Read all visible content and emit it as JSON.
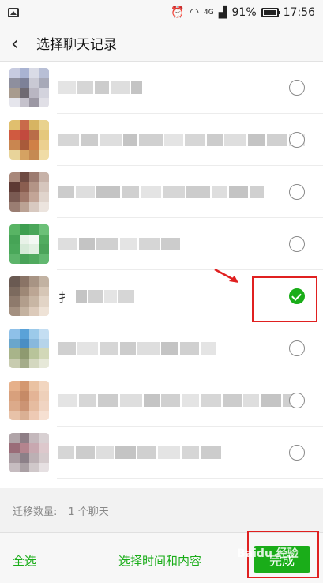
{
  "status": {
    "battery": "91%",
    "time": "17:56",
    "signal_text": "4G",
    "battery_level": 0.91
  },
  "header": {
    "back_icon": "chevron-left-icon",
    "title": "选择聊天记录"
  },
  "chats": [
    {
      "name_visible": "",
      "selected": false
    },
    {
      "name_visible": "",
      "selected": false
    },
    {
      "name_visible": "",
      "selected": false
    },
    {
      "name_visible": "",
      "selected": false
    },
    {
      "name_visible": "扌",
      "selected": true
    },
    {
      "name_visible": "",
      "selected": false
    },
    {
      "name_visible": "",
      "selected": false
    },
    {
      "name_visible": "",
      "selected": false
    }
  ],
  "summary": {
    "label": "迁移数量:",
    "value": "1 个聊天"
  },
  "footer": {
    "select_all": "全选",
    "select_time_content": "选择时间和内容",
    "done": "完成"
  },
  "watermark": "Baidu 经验",
  "colors": {
    "accent": "#1aad19",
    "highlight": "#e02020"
  }
}
